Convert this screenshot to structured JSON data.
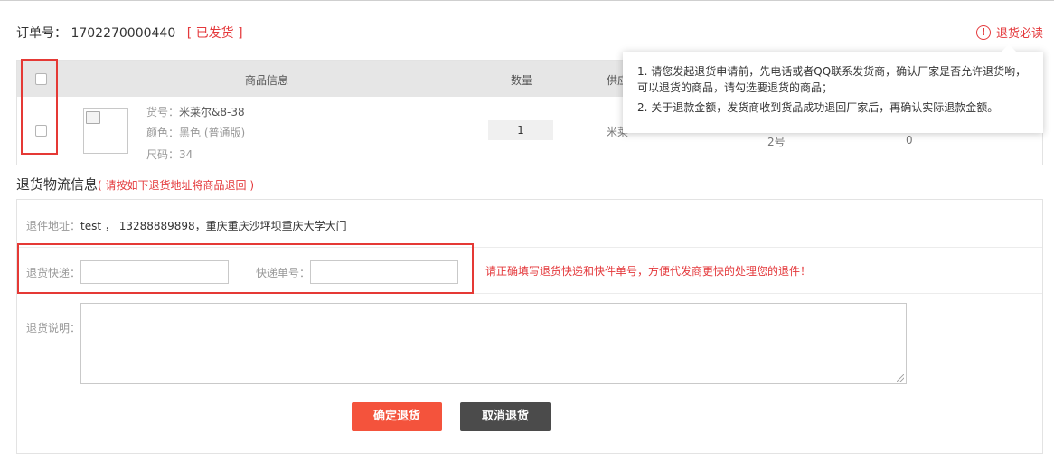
{
  "order": {
    "label": "订单号：",
    "number": "1702270000440",
    "status": "[ 已发货 ]"
  },
  "notice": {
    "icon": "alert-circle-icon",
    "label": "退货必读",
    "lines": [
      "1. 请您发起退货申请前，先电话或者QQ联系发货商，确认厂家是否允许退货哟，",
      "可以退货的商品，请勾选要退货的商品；",
      "2. 关于退款金额，发货商收到货品成功退回厂家后，再确认实际退款金额。"
    ]
  },
  "goods_table": {
    "columns": [
      "商品信息",
      "数量",
      "供应"
    ],
    "row": {
      "sku_label": "货号：",
      "sku_value": "米莱尔&8-38",
      "color_label": "颜色：",
      "color_value": "黑色 (普通版)",
      "size_label": "尺码：",
      "size_value": "34",
      "quantity": "1",
      "supplier_partial": "米莱",
      "col5_partial": "2号",
      "col6_partial": "0"
    }
  },
  "logistics": {
    "title": "退货物流信息",
    "hint": "( 请按如下退货地址将商品退回 )",
    "address_label": "退件地址：",
    "address_value": "test ， 13288889898，重庆重庆沙坪坝重庆大学大门",
    "express_label": "退货快递：",
    "express_value": "",
    "tracking_label": "快递单号：",
    "tracking_value": "",
    "error_hint": "请正确填写退货快递和快件单号，方便代发商更快的处理您的退件！",
    "note_label": "退货说明："
  },
  "buttons": {
    "confirm": "确定退货",
    "cancel": "取消退货"
  },
  "colors": {
    "accent_red": "#e4393c",
    "confirm_button": "#f4533c",
    "cancel_button": "#4b4b4b",
    "highlight_box": "#e53935"
  }
}
